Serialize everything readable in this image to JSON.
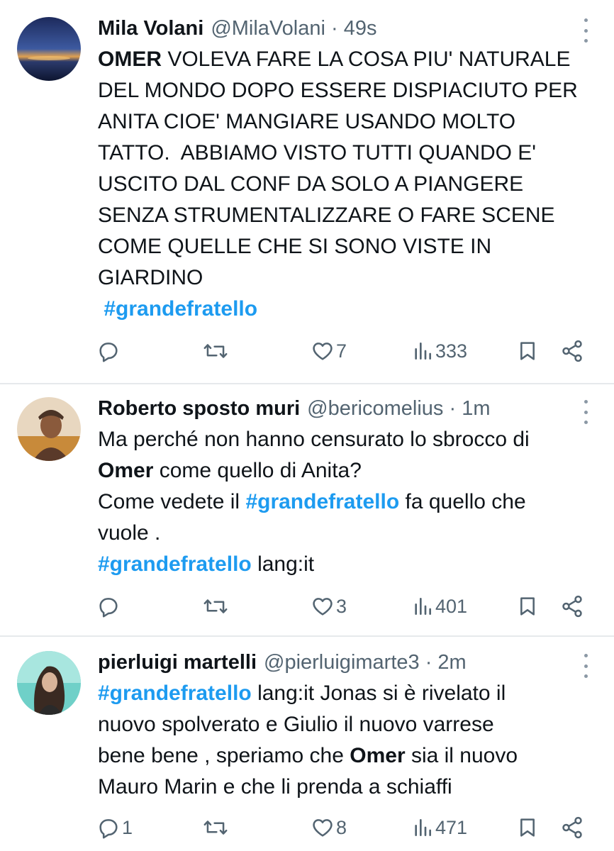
{
  "tweets": [
    {
      "name": "Mila Volani",
      "handle": "@MilaVolani",
      "time": "49s",
      "avatar_icon": "sunset-photo-avatar",
      "lines": [
        [
          {
            "t": "OMER",
            "s": "bold"
          },
          {
            "t": " VOLEVA FARE LA COSA PIU' NATURALE"
          }
        ],
        [
          {
            "t": "DEL MONDO DOPO ESSERE DISPIACIUTO PER"
          }
        ],
        [
          {
            "t": "ANITA CIOE' MANGIARE USANDO MOLTO"
          }
        ],
        [
          {
            "t": "TATTO.  ABBIAMO VISTO TUTTI QUANDO E'"
          }
        ],
        [
          {
            "t": "USCITO DAL CONF DA SOLO A PIANGERE"
          }
        ],
        [
          {
            "t": "SENZA STRUMENTALIZZARE O FARE SCENE"
          }
        ],
        [
          {
            "t": "COME QUELLE CHE SI SONO VISTE IN"
          }
        ],
        [
          {
            "t": "GIARDINO"
          }
        ],
        [
          {
            "t": " #grandefratello",
            "s": "hashtag"
          }
        ]
      ],
      "reply_count": "",
      "retweet_count": "",
      "like_count": "7",
      "view_count": "333"
    },
    {
      "name": "Roberto sposto muri",
      "handle": "@bericomelius",
      "time": "1m",
      "avatar_icon": "man-photo-avatar",
      "lines": [
        [
          {
            "t": "Ma perché non hanno censurato lo sbrocco di"
          }
        ],
        [
          {
            "t": "Omer",
            "s": "bold"
          },
          {
            "t": " come quello di Anita?"
          }
        ],
        [
          {
            "t": "Come vedete il "
          },
          {
            "t": "#grandefratello",
            "s": "hashtag"
          },
          {
            "t": " fa quello che"
          }
        ],
        [
          {
            "t": "vuole ."
          }
        ],
        [
          {
            "t": "#grandefratello",
            "s": "hashtag"
          },
          {
            "t": " lang:it"
          }
        ]
      ],
      "reply_count": "",
      "retweet_count": "",
      "like_count": "3",
      "view_count": "401"
    },
    {
      "name": "pierluigi martelli",
      "handle": "@pierluigimarte3",
      "time": "2m",
      "avatar_icon": "woman-photo-avatar",
      "lines": [
        [
          {
            "t": "#grandefratello",
            "s": "hashtag"
          },
          {
            "t": " lang:it Jonas si è rivelato il"
          }
        ],
        [
          {
            "t": "nuovo spolverato e Giulio il nuovo varrese"
          }
        ],
        [
          {
            "t": "bene bene , speriamo che "
          },
          {
            "t": "Omer",
            "s": "bold"
          },
          {
            "t": " sia il nuovo"
          }
        ],
        [
          {
            "t": "Mauro Marin e che li prenda a schiaffi"
          }
        ]
      ],
      "reply_count": "1",
      "retweet_count": "",
      "like_count": "8",
      "view_count": "471"
    }
  ],
  "colors": {
    "text": "#0f1419",
    "secondary": "#536471",
    "hashtag": "#1d9bf0",
    "divider": "#e6e9ec"
  }
}
